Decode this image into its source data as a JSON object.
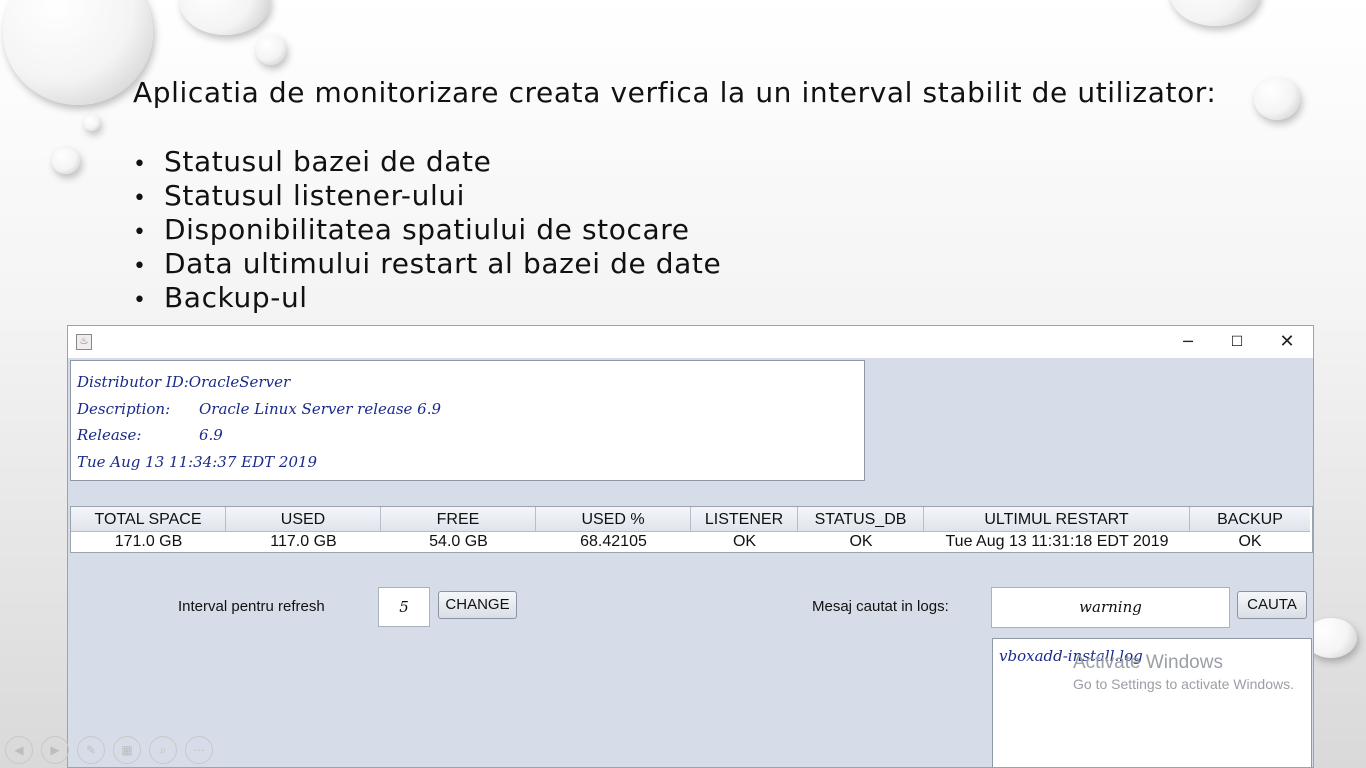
{
  "slide": {
    "title": "Aplicatia de monitorizare creata verfica la un interval stabilit de utilizator:",
    "bullets": [
      "Statusul bazei de date",
      "Statusul listener-ului",
      "Disponibilitatea spatiului de stocare",
      "Data ultimului restart al bazei de date",
      "Backup-ul"
    ]
  },
  "window": {
    "controls": {
      "minimize": "─",
      "maximize": "☐",
      "close": "✕"
    },
    "info": {
      "distributor": "Distributor ID:OracleServer",
      "description_key": "Description:",
      "description_val": "Oracle Linux Server release 6.9",
      "release_key": "Release:",
      "release_val": "6.9",
      "date": "Tue Aug 13 11:34:37 EDT 2019"
    },
    "table": {
      "headers": [
        "TOTAL SPACE",
        "USED",
        "FREE",
        "USED %",
        "LISTENER",
        "STATUS_DB",
        "ULTIMUL RESTART",
        "BACKUP"
      ],
      "row": [
        "171.0 GB",
        "117.0 GB",
        "54.0 GB",
        "68.42105",
        "OK",
        "OK",
        "Tue Aug 13 11:31:18 EDT 2019",
        "OK"
      ]
    },
    "refresh": {
      "label": "Interval pentru refresh",
      "value": "5",
      "button": "CHANGE"
    },
    "search": {
      "label": "Mesaj cautat in logs:",
      "value": "warning",
      "button": "CAUTA"
    },
    "log_result": "vboxadd-install.log"
  },
  "watermark": {
    "title": "Activate Windows",
    "subtitle": "Go to Settings to activate Windows."
  },
  "nav_icons": [
    "back-icon",
    "forward-icon",
    "pen-icon",
    "slides-icon",
    "zoom-icon",
    "more-icon"
  ]
}
